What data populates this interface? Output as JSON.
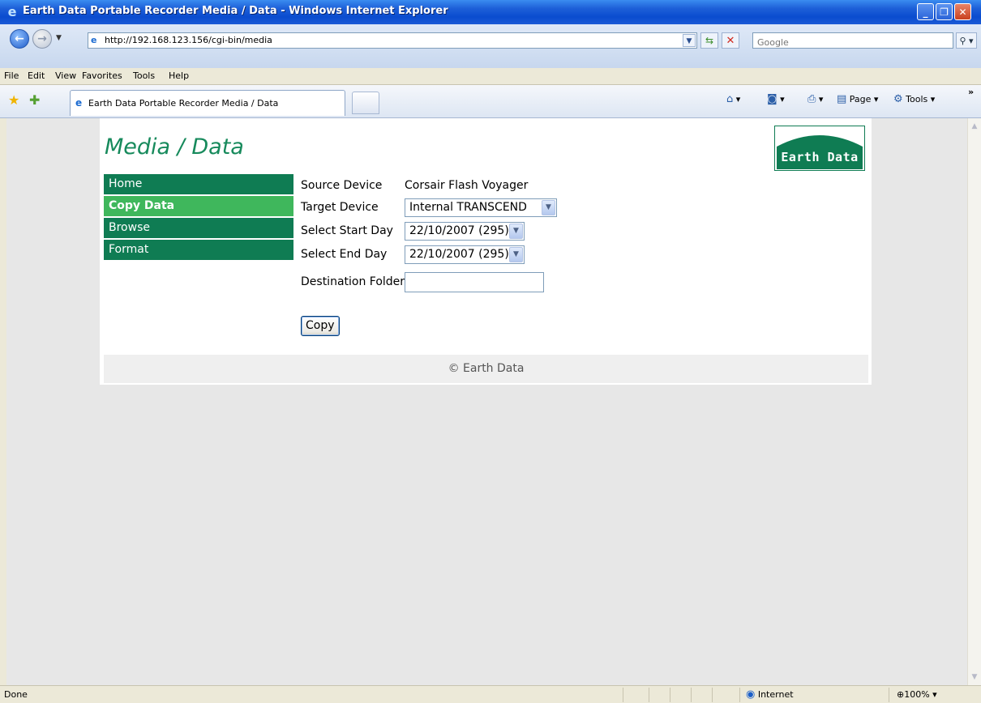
{
  "window": {
    "title": "Earth Data Portable Recorder Media / Data - Windows Internet Explorer"
  },
  "navigation": {
    "url": "http://192.168.123.156/cgi-bin/media",
    "search_placeholder": "Google"
  },
  "menu": {
    "items": [
      "File",
      "Edit",
      "View",
      "Favorites",
      "Tools",
      "Help"
    ]
  },
  "tabs": [
    {
      "label": "Earth Data Portable Recorder Media / Data",
      "active": true
    }
  ],
  "toolbar": {
    "page_label": "Page",
    "tools_label": "Tools"
  },
  "page": {
    "title": "Media / Data",
    "logo_text": "Earth Data",
    "nav": [
      {
        "label": "Home",
        "active": false
      },
      {
        "label": "Copy Data",
        "active": true
      },
      {
        "label": "Browse",
        "active": false
      },
      {
        "label": "Format",
        "active": false
      }
    ],
    "form": {
      "source_label": "Source Device",
      "source_value": "Corsair Flash Voyager",
      "target_label": "Target Device",
      "target_value": "Internal TRANSCEND",
      "start_label": "Select Start Day",
      "start_value": "22/10/2007 (295)",
      "end_label": "Select End Day",
      "end_value": "22/10/2007 (295)",
      "folder_label": "Destination Folder",
      "folder_value": "",
      "copy_label": "Copy"
    },
    "footer": "© Earth Data"
  },
  "status": {
    "text": "Done",
    "zone": "Internet",
    "zoom": "100%"
  },
  "colors": {
    "nav_bg": "#0f7c53",
    "nav_active": "#3fb75c",
    "title_green": "#178a5c"
  }
}
